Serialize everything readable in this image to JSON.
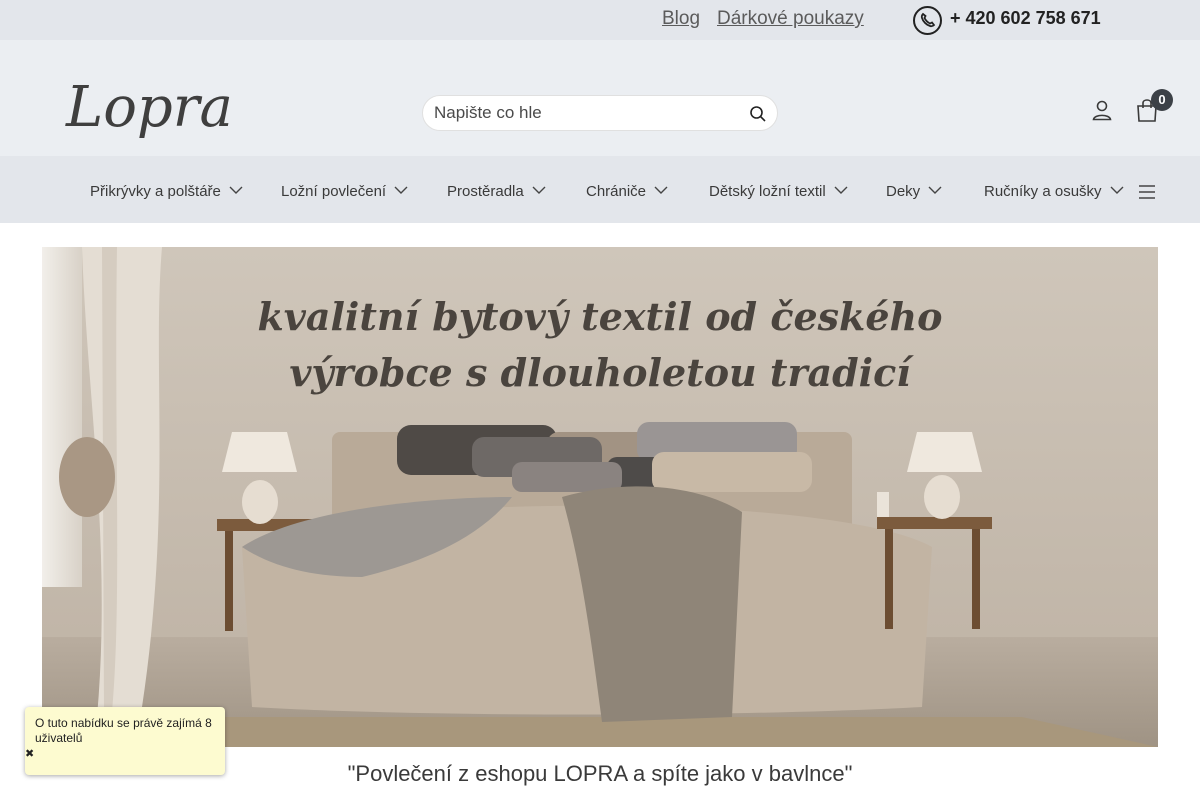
{
  "topbar": {
    "blog": "Blog",
    "vouchers": "Dárkové poukazy",
    "phone": "+ 420 602 758 671"
  },
  "header": {
    "logo_text": "Lopra",
    "search_placeholder": "Napište co hle",
    "cart_count": "0"
  },
  "nav": {
    "items": [
      {
        "label": "Přikrývky a polštáře"
      },
      {
        "label": "Ložní povlečení"
      },
      {
        "label": "Prostěradla"
      },
      {
        "label": "Chrániče"
      },
      {
        "label": "Dětský ložní textil"
      },
      {
        "label": "Deky"
      },
      {
        "label": "Ručníky a osušky"
      }
    ]
  },
  "hero": {
    "line1": "kvalitní bytový textil od českého",
    "line2": "výrobce s dlouholetou tradicí"
  },
  "quote": "\"Povlečení z eshopu LOPRA a spíte jako v bavlnce\"",
  "notice": {
    "text": "O tuto nabídku se právě zajímá 8 uživatelů",
    "close": "✖"
  }
}
